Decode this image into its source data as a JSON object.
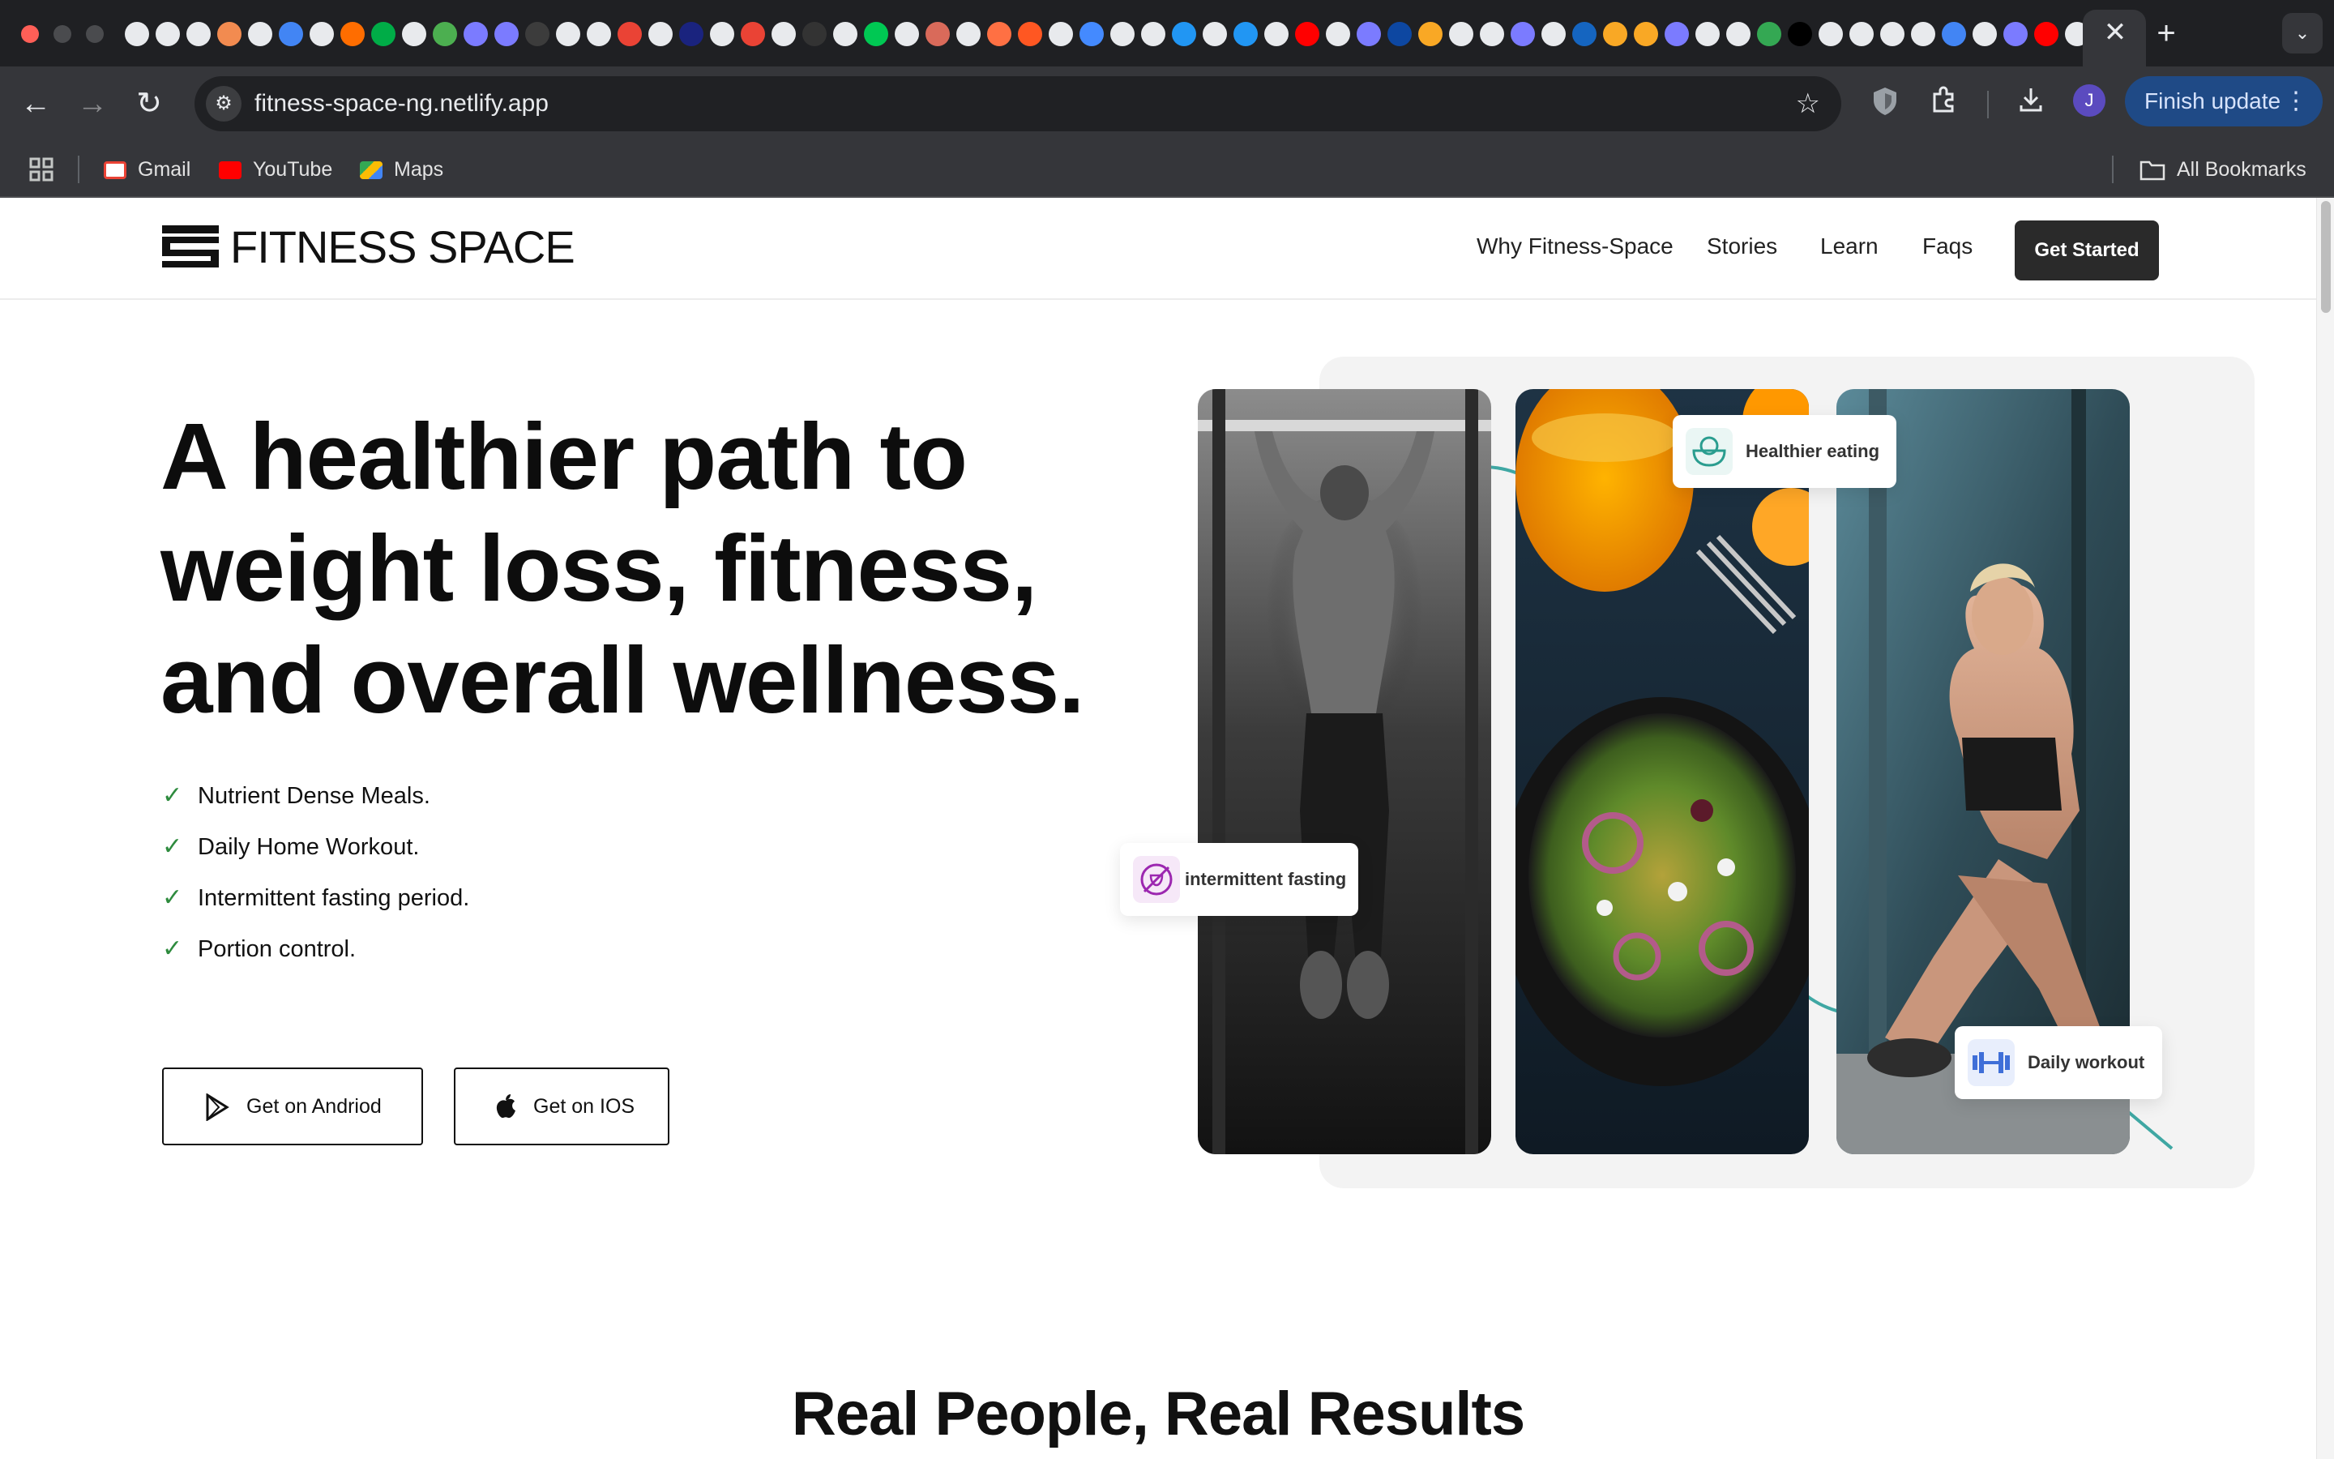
{
  "browser": {
    "active_tab_close": "✕",
    "new_tab": "+",
    "tab_search": "⌄",
    "url": "fitness-space-ng.netlify.app",
    "profile_initial": "J",
    "finish_update": "Finish update",
    "finish_menu": "⋮",
    "bookmarks": [
      {
        "label": "Gmail",
        "icon": "gmail-icon",
        "color": "#ea4335"
      },
      {
        "label": "YouTube",
        "icon": "youtube-icon",
        "color": "#ff0000"
      },
      {
        "label": "Maps",
        "icon": "maps-icon",
        "color": "#34a853"
      }
    ],
    "all_bookmarks": "All Bookmarks",
    "tab_favicon_colors": [
      "#e8eaed",
      "#e8eaed",
      "#e8eaed",
      "#f28b50",
      "#e8eaed",
      "#4285f4",
      "#e8eaed",
      "#ff6d00",
      "#00ac47",
      "#e8eaed",
      "#4caf50",
      "#7b7bff",
      "#7b7bff",
      "#3c3c3c",
      "#e8eaed",
      "#e8eaed",
      "#ea4335",
      "#e8eaed",
      "#1a237e",
      "#e8eaed",
      "#ea4335",
      "#e8eaed",
      "#333333",
      "#e8eaed",
      "#00c853",
      "#e8eaed",
      "#d96a5a",
      "#e8eaed",
      "#ff7043",
      "#ff5722",
      "#e8eaed",
      "#448aff",
      "#e8eaed",
      "#e8eaed",
      "#2196f3",
      "#e8eaed",
      "#2196f3",
      "#e8eaed",
      "#ff0000",
      "#e8eaed",
      "#7b7bff",
      "#0d47a1",
      "#f9a825",
      "#e8eaed",
      "#e8eaed",
      "#7b7bff",
      "#e8eaed",
      "#1565c0",
      "#f9a825",
      "#f9a825",
      "#7b7bff",
      "#e8eaed",
      "#e8eaed",
      "#34a853",
      "#000000",
      "#e8eaed",
      "#e8eaed",
      "#e8eaed",
      "#e8eaed",
      "#4285f4",
      "#e8eaed",
      "#7b7bff",
      "#ff0000",
      "#e8eaed",
      "#e8eaed"
    ]
  },
  "site": {
    "logo": "FITNESS SPACE",
    "nav": [
      "Why Fitness-Space",
      "Stories",
      "Learn",
      "Faqs"
    ],
    "cta": "Get Started"
  },
  "hero": {
    "title": "A healthier path to weight loss, fitness, and overall wellness.",
    "features": [
      "Nutrient Dense Meals.",
      "Daily Home Workout.",
      "Intermittent fasting period.",
      "Portion control."
    ],
    "android_button": "Get on Andriod",
    "ios_button": "Get on IOS",
    "badges": {
      "eating": {
        "label": "Healthier eating",
        "icon": "bowl-icon",
        "color": "#2a9d8f"
      },
      "fasting": {
        "label": "intermittent fasting",
        "icon": "no-food-icon",
        "color": "#9c27b0"
      },
      "workout": {
        "label": "Daily workout",
        "icon": "dumbbell-icon",
        "color": "#3f6fd8"
      }
    },
    "photos": [
      "pull-up-photo",
      "salad-photo",
      "situp-photo"
    ]
  },
  "next_section": {
    "title": "Real People, Real Results"
  },
  "colors": {
    "accent_teal": "#3fa7a3",
    "check_green": "#2e8b3e",
    "cta_bg": "#2a2a2a"
  }
}
